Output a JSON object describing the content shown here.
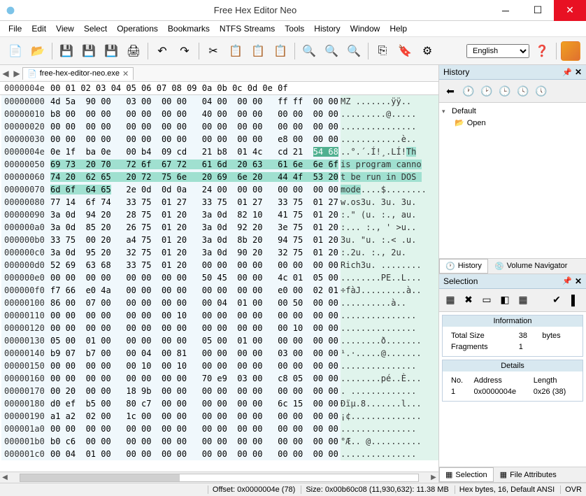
{
  "title": "Free Hex Editor Neo",
  "menu": [
    "File",
    "Edit",
    "View",
    "Select",
    "Operations",
    "Bookmarks",
    "NTFS Streams",
    "Tools",
    "History",
    "Window",
    "Help"
  ],
  "language": "English",
  "tab": {
    "name": "free-hex-editor-neo.exe"
  },
  "header_addr": "0000004e",
  "header_cols": "00 01  02 03   04 05  06 07   08 09  0a 0b   0c 0d  0e 0f",
  "rows": [
    {
      "a": "00000000",
      "b": "4d 5a  90 00   03 00  00 00   04 00  00 00   ff ff  00 00",
      "t": "MZ .......ÿÿ.."
    },
    {
      "a": "00000010",
      "b": "b8 00  00 00   00 00  00 00   40 00  00 00   00 00  00 00",
      "t": ".........@....."
    },
    {
      "a": "00000020",
      "b": "00 00  00 00   00 00  00 00   00 00  00 00   00 00  00 00",
      "t": "..............."
    },
    {
      "a": "00000030",
      "b": "00 00  00 00   00 00  00 00   00 00  00 00   e8 00  00 00",
      "t": "............è.."
    },
    {
      "a": "0000004e",
      "b": "0e 1f  ba 0e   00 b4  09 cd   21 b8  01 4c   cd 21  ",
      "bsel": "54 68",
      "t": "..°.´.Í!¸.LÍ!",
      "tsel": "Th"
    },
    {
      "a": "00000050",
      "bsel": "69 73  20 70   72 6f  67 72   61 6d  20 63   61 6e  6e 6f",
      "tsel": "is program canno"
    },
    {
      "a": "00000060",
      "bsel": "74 20  62 65   20 72  75 6e   20 69  6e 20   44 4f  53 20",
      "tsel": "t be run in DOS "
    },
    {
      "a": "00000070",
      "bsel": "6d 6f  64 65",
      "b2": "   2e 0d  0d 0a   24 00  00 00   00 00  00 00",
      "tsel": "mode",
      "t2": "....$........"
    },
    {
      "a": "00000080",
      "b": "77 14  6f 74   33 75  01 27   33 75  01 27   33 75  01 27",
      "t": "w.os3u. 3u. 3u."
    },
    {
      "a": "00000090",
      "b": "3a 0d  94 20   28 75  01 20   3a 0d  82 10   41 75  01 20",
      "t": ":.\" (u. :., au."
    },
    {
      "a": "000000a0",
      "b": "3a 0d  85 20   26 75  01 20   3a 0d  92 20   3e 75  01 20",
      "t": ":... :., ' >u.."
    },
    {
      "a": "000000b0",
      "b": "33 75  00 20   a4 75  01 20   3a 0d  8b 20   94 75  01 20",
      "t": "3u. \"u. :.< .u."
    },
    {
      "a": "000000c0",
      "b": "3a 0d  95 20   32 75  01 20   3a 0d  90 20   32 75  01 20",
      "t": ":.2u. :., 2u."
    },
    {
      "a": "000000d0",
      "b": "52 69  63 68   33 75  01 20   00 00  00 00   00 00  00 00",
      "t": "Rich3u. ........"
    },
    {
      "a": "000000e0",
      "b": "00 00  00 00   00 00  00 00   50 45  00 00   4c 01  05 00",
      "t": "........PE..L..."
    },
    {
      "a": "000000f0",
      "b": "f7 66  e0 4a   00 00  00 00   00 00  00 00   e0 00  02 01",
      "t": "÷fàJ.........à.."
    },
    {
      "a": "00000100",
      "b": "86 00  07 00   00 00  00 00   00 04  01 00   00 50  00 00",
      "t": "..........à.."
    },
    {
      "a": "00000110",
      "b": "00 00  00 00   00 00  00 10   00 00  00 00   00 00  00 00",
      "t": "..............."
    },
    {
      "a": "00000120",
      "b": "00 00  00 00   00 00  00 00   00 00  00 00   00 10  00 00",
      "t": "..............."
    },
    {
      "a": "00000130",
      "b": "05 00  01 00   00 00  00 00   05 00  01 00   00 00  00 00",
      "t": "........ð......."
    },
    {
      "a": "00000140",
      "b": "b9 07  b7 00   00 04  00 81   00 00  00 00   03 00  00 00",
      "t": "¹.·.....@......."
    },
    {
      "a": "00000150",
      "b": "00 00  00 00   00 10  00 10   00 00  00 00   00 00  00 00",
      "t": "..............."
    },
    {
      "a": "00000160",
      "b": "00 00  00 00   00 00  00 00   70 e9  03 00   c8 05  00 00",
      "t": "........pé..È..."
    },
    {
      "a": "00000170",
      "b": "00 20  00 00   18 9b  00 00   00 00  00 00   00 00  00 00",
      "t": ". ............."
    },
    {
      "a": "00000180",
      "b": "d0 ef  b5 00   80 c7  00 00   00 00  00 00   6c 15  00 00",
      "t": "Ðïµ.8.......l..."
    },
    {
      "a": "00000190",
      "b": "a1 a2  02 00   1c 00  00 00   00 00  00 00   00 00  00 00",
      "t": "¡¢.............."
    },
    {
      "a": "000001a0",
      "b": "00 00  00 00   00 00  00 00   00 00  00 00   00 00  00 00",
      "t": "..............."
    },
    {
      "a": "000001b0",
      "b": "b0 c6  00 00   00 00  00 00   00 00  00 00   00 00  00 00",
      "t": "°Æ.. @.........."
    },
    {
      "a": "000001c0",
      "b": "00 04  01 00   00 00  00 00   00 00  00 00   00 00  00 00",
      "t": "..............."
    }
  ],
  "history": {
    "title": "History",
    "nodes": [
      {
        "label": "Default",
        "expanded": true,
        "children": [
          {
            "label": "Open"
          }
        ]
      }
    ]
  },
  "history_tabs": {
    "active": "History",
    "inactive": "Volume Navigator"
  },
  "selection": {
    "title": "Selection",
    "info_hdr": "Information",
    "total_label": "Total Size",
    "total_val": "38",
    "total_unit": "bytes",
    "frag_label": "Fragments",
    "frag_val": "1",
    "details_hdr": "Details",
    "cols": [
      "No.",
      "Address",
      "Length"
    ],
    "row": [
      "1",
      "0x0000004e",
      "0x26 (38)"
    ]
  },
  "selection_tabs": {
    "active": "Selection",
    "inactive": "File Attributes"
  },
  "status": {
    "offset": "Offset: 0x0000004e (78)",
    "size": "Size: 0x00b60c08 (11,930,632): 11.38 MB",
    "mode": "Hex bytes, 16, Default ANSI",
    "ovr": "OVR"
  }
}
